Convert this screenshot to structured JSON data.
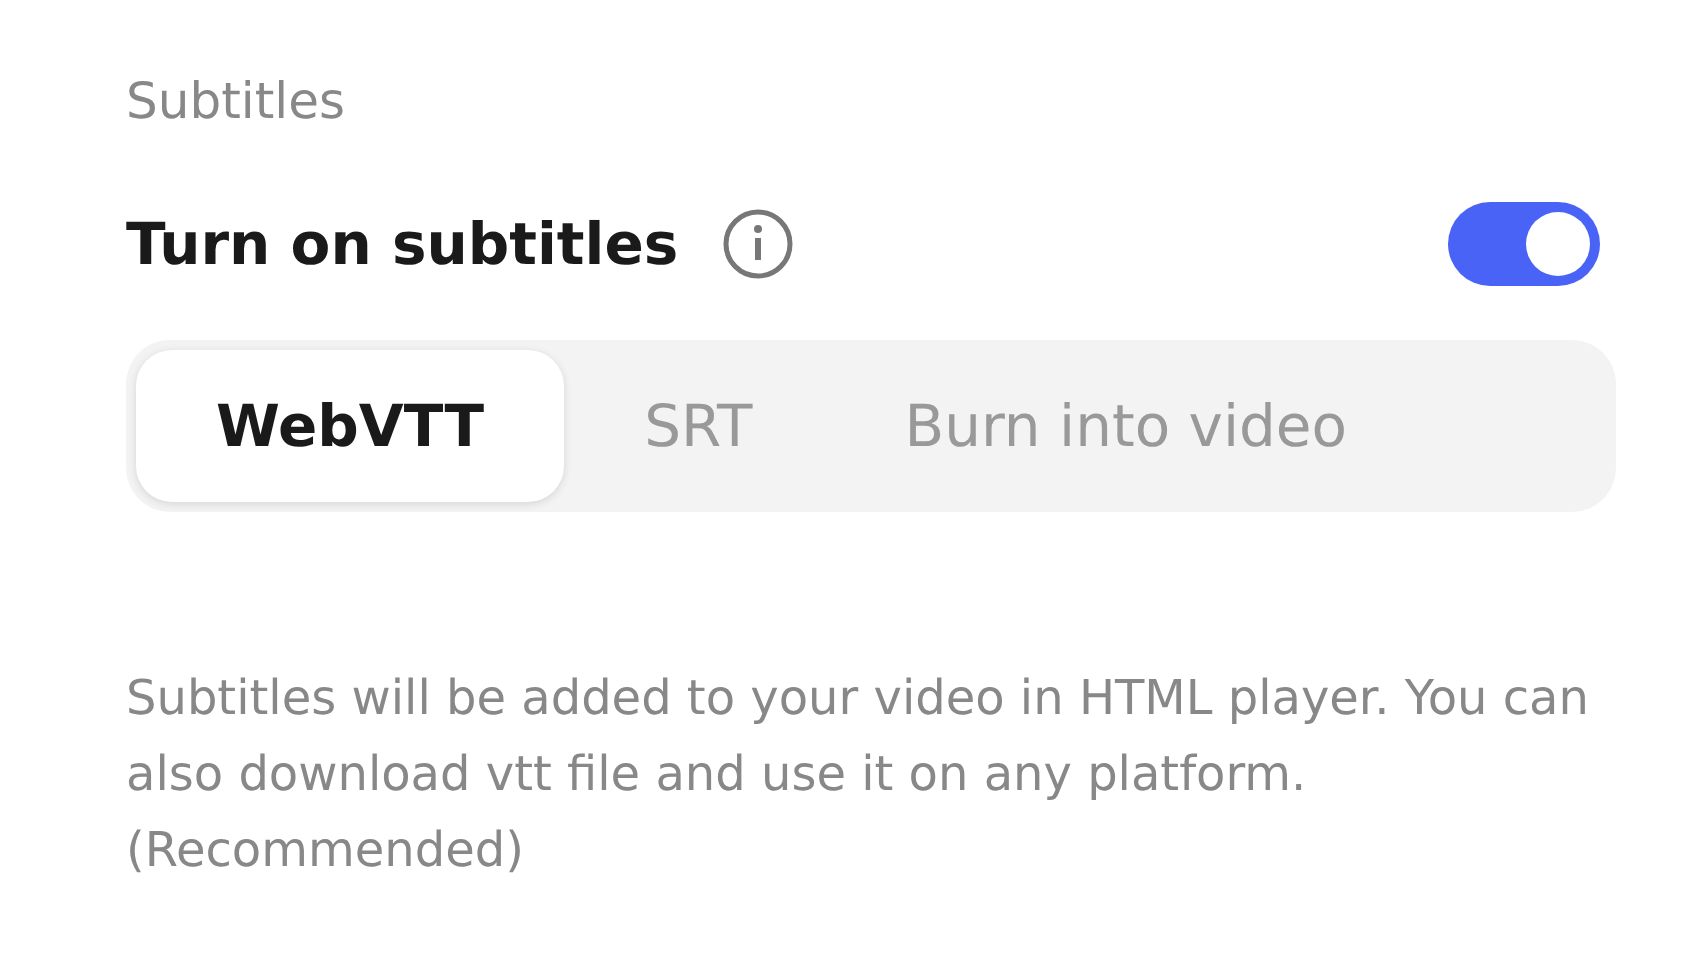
{
  "section_title": "Subtitles",
  "setting": {
    "label": "Turn on subtitles",
    "on": true
  },
  "tabs": [
    {
      "label": "WebVTT",
      "selected": true
    },
    {
      "label": "SRT",
      "selected": false
    },
    {
      "label": "Burn into video",
      "selected": false
    }
  ],
  "description": "Subtitles will be added to your video in HTML player. You can also download vtt file and use it on any platform. (Recommended)"
}
